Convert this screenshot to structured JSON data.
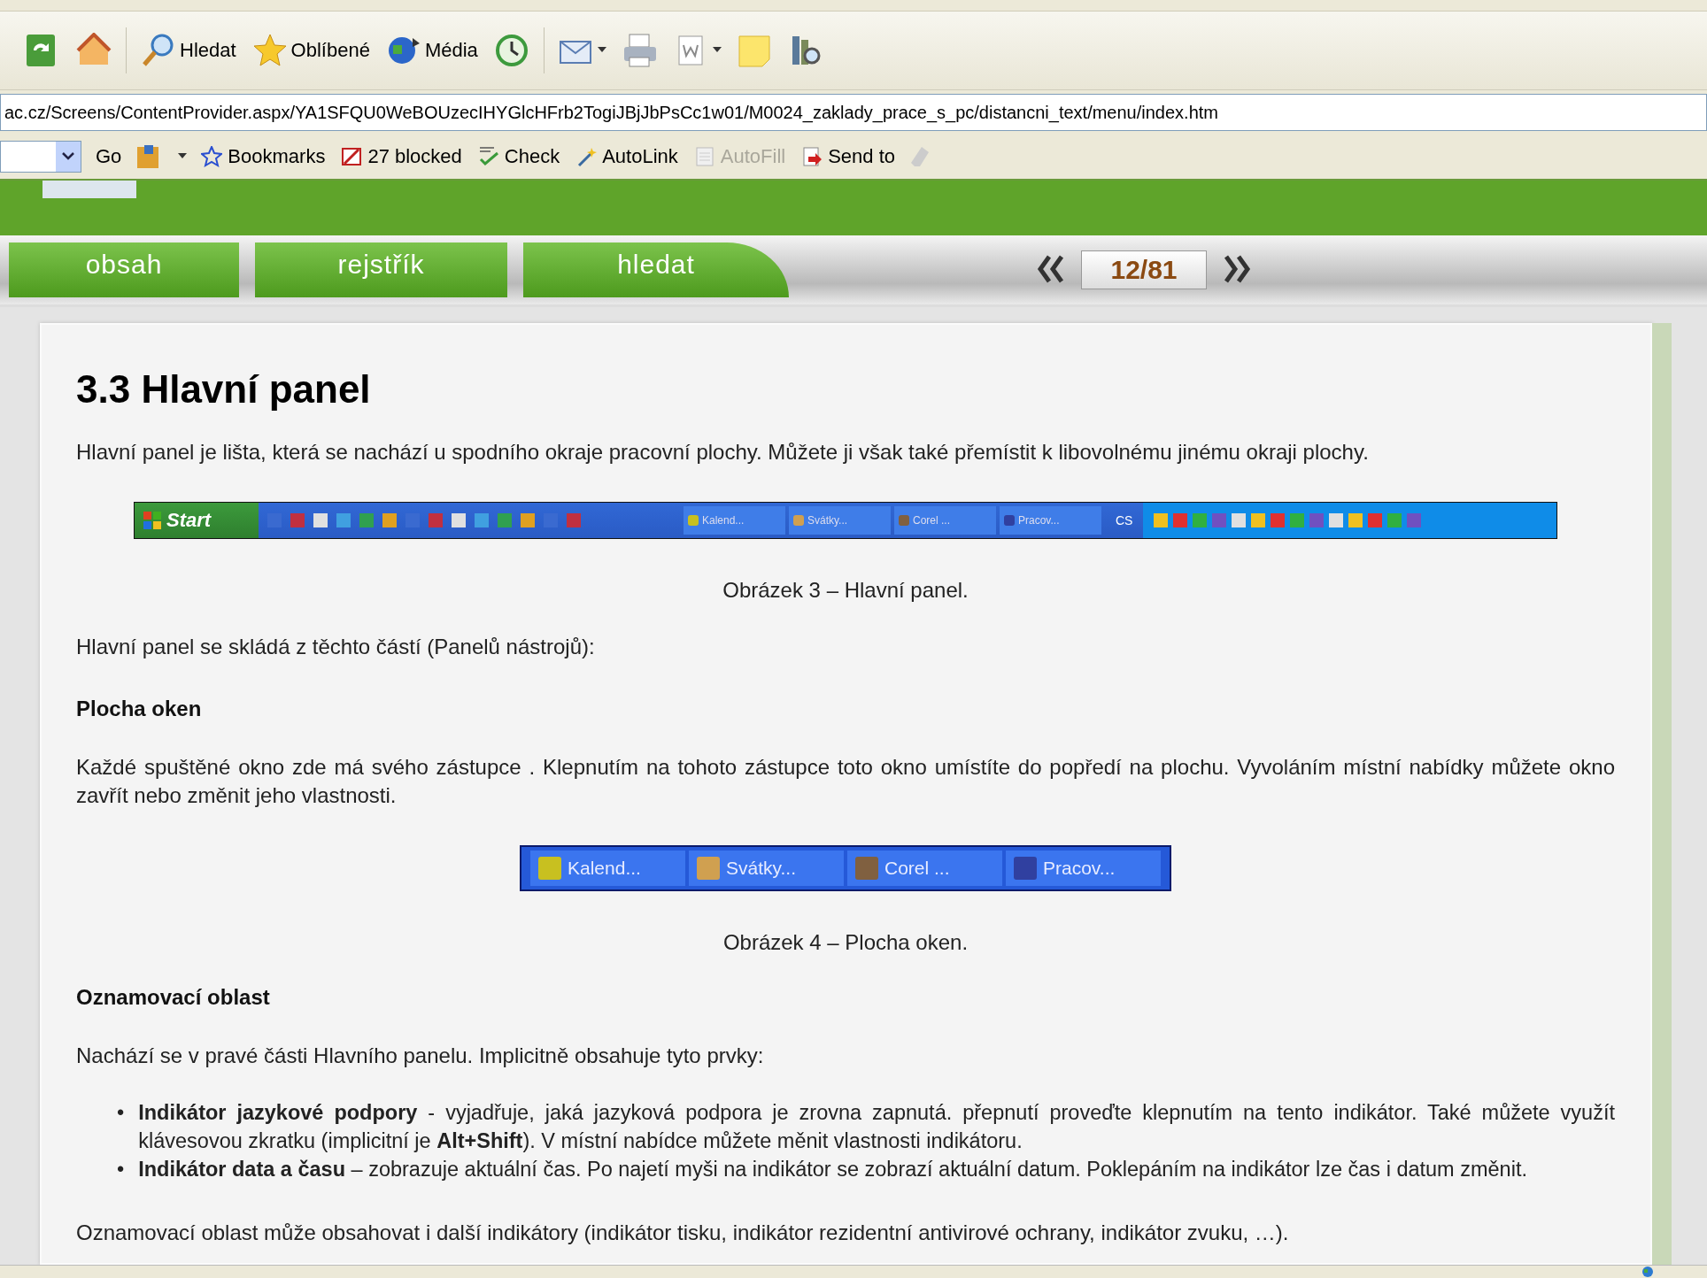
{
  "toolbar": {
    "buttons": [
      {
        "kind": "refresh"
      },
      {
        "kind": "home"
      },
      {
        "kind": "search",
        "label": "Hledat"
      },
      {
        "kind": "favorites",
        "label": "Oblíbené"
      },
      {
        "kind": "media",
        "label": "Média"
      },
      {
        "kind": "history"
      },
      {
        "kind": "mail",
        "dropdown": true
      },
      {
        "kind": "print"
      },
      {
        "kind": "word",
        "dropdown": true
      },
      {
        "kind": "note"
      },
      {
        "kind": "research"
      }
    ]
  },
  "address_bar": {
    "value": "ac.cz/Screens/ContentProvider.aspx/YA1SFQU0WeBOUzecIHYGlcHFrb2TogiJBjJbPsCc1w01/M0024_zaklady_prace_s_pc/distancni_text/menu/index.htm"
  },
  "links_toolbar": {
    "go": "Go",
    "items": [
      {
        "kind": "bookmarks",
        "label": "Bookmarks",
        "disabled": false
      },
      {
        "kind": "blocked",
        "label": "27 blocked",
        "disabled": false
      },
      {
        "kind": "check",
        "label": "Check",
        "disabled": false
      },
      {
        "kind": "autolink",
        "label": "AutoLink",
        "disabled": false
      },
      {
        "kind": "autofill",
        "label": "AutoFill",
        "disabled": true
      },
      {
        "kind": "sendto",
        "label": "Send to",
        "disabled": false
      }
    ]
  },
  "nav": {
    "tabs": [
      "obsah",
      "rejstřík",
      "hledat"
    ],
    "page": "12/81"
  },
  "article": {
    "heading": "3.3 Hlavní panel",
    "blocks": [
      {
        "kind": "paragraph",
        "text": "Hlavní panel je lišta, která se nachází u spodního okraje pracovní plochy. Můžete ji však také přemístit k libovolnému jinému okraji plochy."
      },
      {
        "kind": "taskbar_figure",
        "start": "Start",
        "windows": [
          "Kalend...",
          "Svátky...",
          "Corel ...",
          "Pracov..."
        ],
        "language": "CS"
      },
      {
        "kind": "caption",
        "text": "Obrázek 3 – Hlavní panel."
      },
      {
        "kind": "paragraph",
        "text": "Hlavní panel se skládá z těchto částí (Panelů nástrojů):"
      },
      {
        "kind": "subheading",
        "text": "Plocha oken"
      },
      {
        "kind": "paragraph",
        "text": "Každé spuštěné okno zde má svého zástupce . Klepnutím na tohoto zástupce toto okno umístíte do popředí na plochu. Vyvoláním místní nabídky můžete okno zavřít nebo změnit jeho vlastnosti."
      },
      {
        "kind": "windows_figure",
        "windows": [
          "Kalend...",
          "Svátky...",
          "Corel ...",
          "Pracov..."
        ]
      },
      {
        "kind": "caption",
        "text": "Obrázek 4 – Plocha oken."
      },
      {
        "kind": "subheading",
        "text": "Oznamovací oblast"
      },
      {
        "kind": "paragraph",
        "text": "Nachází se v pravé části Hlavního panelu. Implicitně obsahuje tyto prvky:"
      },
      {
        "kind": "bullets",
        "marker": "•",
        "items": [
          "**Indikátor jazykové podpory** - vyjadřuje, jaká jazyková podpora je zrovna zapnutá. přepnutí proveďte klepnutím na tento indikátor. Také můžete využít klávesovou zkratku (implicitní je **Alt+Shift**). V místní nabídce můžete měnit vlastnosti indikátoru.",
          "**Indikátor data a času** – zobrazuje aktuální čas. Po najetí myši na indikátor se zobrazí aktuální datum. Poklepáním na indikátor lze čas i datum změnit."
        ]
      },
      {
        "kind": "paragraph",
        "text": "Oznamovací oblast může obsahovat i další indikátory (indikátor tisku, indikátor rezidentní antivirové ochrany, indikátor zvuku, …)."
      }
    ]
  }
}
